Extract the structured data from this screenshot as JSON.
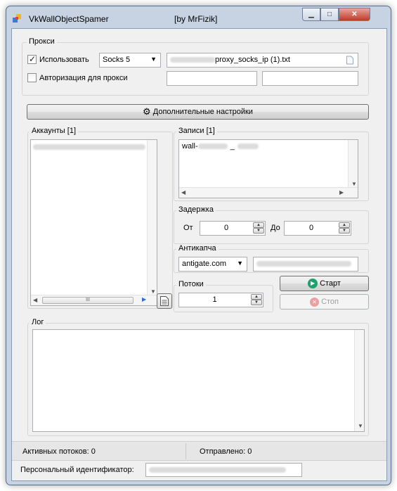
{
  "window": {
    "title": "VkWallObjectSpamer",
    "title_by": "[by MrFizik]",
    "controls": {
      "minimize": "▁",
      "maximize": "□",
      "close": "✕"
    }
  },
  "proxy": {
    "group_title": "Прокси",
    "use_label": "Использовать",
    "use_checked": true,
    "type_value": "Socks 5",
    "file_value": "proxy_socks_ip (1).txt",
    "auth_label": "Авторизация для прокси",
    "auth_checked": false,
    "login_value": "",
    "password_value": ""
  },
  "settings_button": "Дополнительные настройки",
  "accounts": {
    "group_title": "Аккаунты [1]",
    "scroll_mid": "III"
  },
  "records": {
    "group_title": "Записи [1]",
    "item_prefix": "wall-",
    "item_sep": "_"
  },
  "delay": {
    "group_title": "Задержка",
    "from_label": "От",
    "from_value": "0",
    "to_label": "До",
    "to_value": "0"
  },
  "anticaptcha": {
    "group_title": "Антикапча",
    "service_value": "antigate.com"
  },
  "threads": {
    "group_title": "Потоки",
    "value": "1"
  },
  "actions": {
    "start_label": "Старт",
    "stop_label": "Стоп"
  },
  "log": {
    "group_title": "Лог"
  },
  "status": {
    "active_threads": "Активных потоков: 0",
    "sent": "Отправлено: 0"
  },
  "personal_id": {
    "label": "Персональный идентификатор:"
  },
  "colors": {
    "window_frame": "#c7d3e3",
    "client_bg": "#f0f0f0",
    "start_icon": "#1aa36a",
    "stop_icon": "#e07070"
  }
}
